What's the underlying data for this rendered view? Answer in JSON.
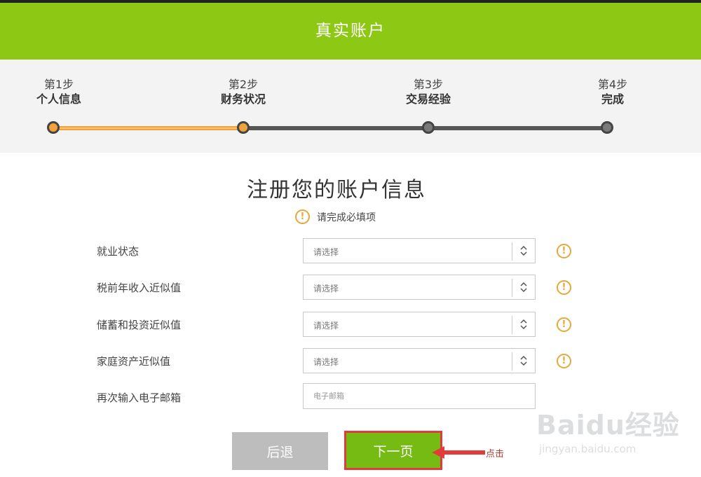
{
  "header": {
    "title": "真实账户"
  },
  "steps": [
    {
      "num": "第1步",
      "name": "个人信息",
      "status": "done"
    },
    {
      "num": "第2步",
      "name": "财务状况",
      "status": "current"
    },
    {
      "num": "第3步",
      "name": "交易经验",
      "status": "todo"
    },
    {
      "num": "第4步",
      "name": "完成",
      "status": "todo"
    }
  ],
  "form": {
    "title": "注册您的账户信息",
    "notice": "请完成必填项",
    "fields": [
      {
        "label": "就业状态",
        "value": "请选择"
      },
      {
        "label": "税前年收入近似值",
        "value": "请选择"
      },
      {
        "label": "储蓄和投资近似值",
        "value": "请选择"
      },
      {
        "label": "家庭资产近似值",
        "value": "请选择"
      }
    ],
    "email": {
      "label": "再次输入电子邮箱",
      "placeholder": "电子邮箱"
    }
  },
  "buttons": {
    "back": "后退",
    "next": "下一页"
  },
  "annotation": {
    "text": "点击"
  },
  "watermark": {
    "logo": "Baidu经验",
    "url": "jingyan.baidu.com"
  },
  "colors": {
    "brand_green": "#8dc814",
    "progress_orange": "#f0a33a",
    "warning": "#e6a83a",
    "annotation_red": "#e23b3b"
  }
}
